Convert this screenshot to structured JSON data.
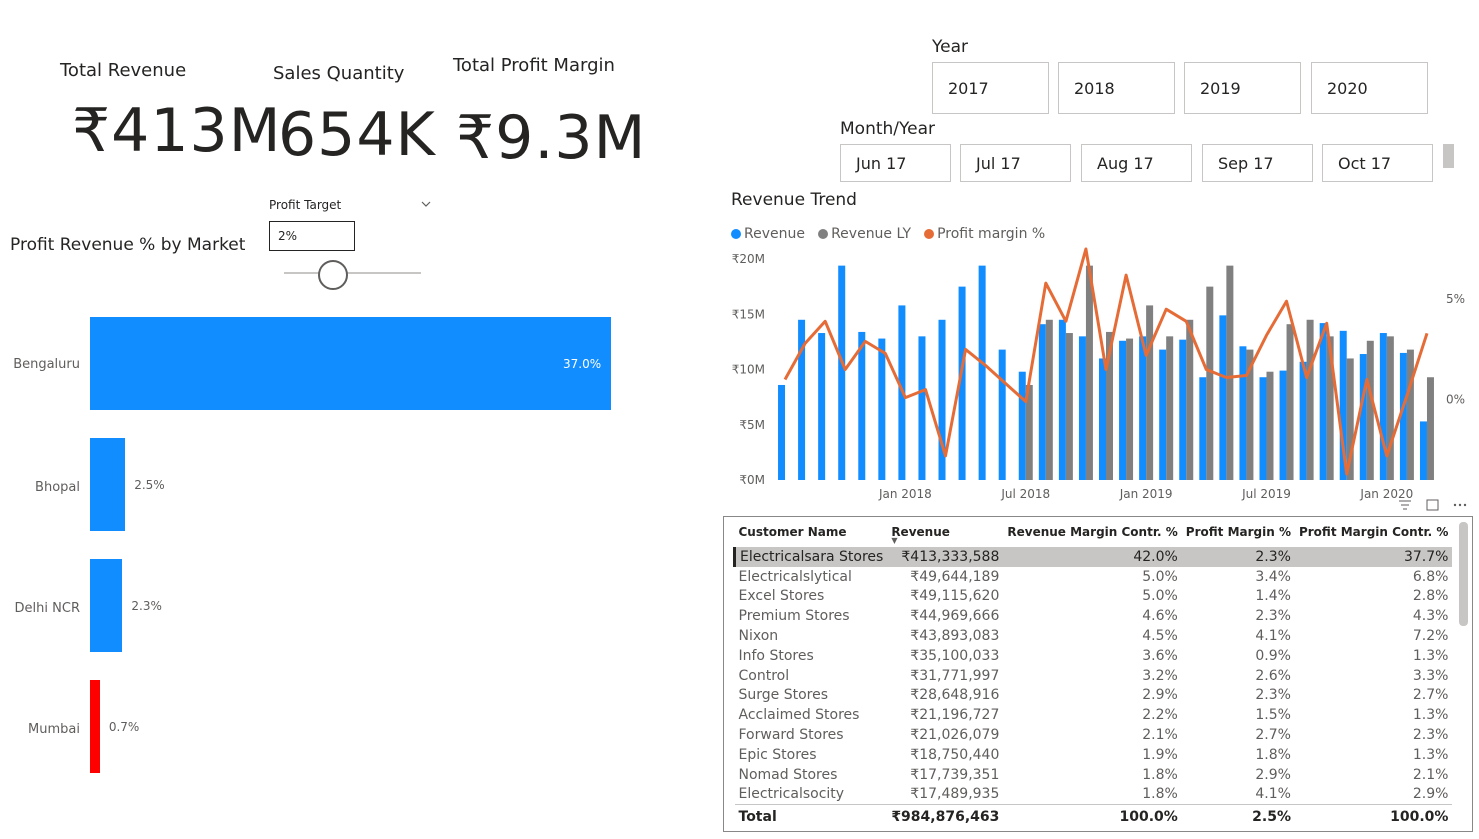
{
  "kpis": {
    "revenue": {
      "title": "Total Revenue",
      "value": "₹413M"
    },
    "quantity": {
      "title": "Sales Quantity",
      "value": "654K"
    },
    "profit": {
      "title": "Total Profit Margin",
      "value": "₹9.3M"
    }
  },
  "profit_target": {
    "label": "Profit Target",
    "value": "2%",
    "slider_fraction": 0.36
  },
  "market_chart": {
    "title": "Profit Revenue % by Market",
    "bars": [
      {
        "name": "Bengaluru",
        "value": 37.0,
        "label": "37.0%",
        "color": "#118DFF"
      },
      {
        "name": "Bhopal",
        "value": 2.5,
        "label": "2.5%",
        "color": "#118DFF"
      },
      {
        "name": "Delhi NCR",
        "value": 2.3,
        "label": "2.3%",
        "color": "#118DFF"
      },
      {
        "name": "Mumbai",
        "value": 0.7,
        "label": "0.7%",
        "color": "#FF0000"
      }
    ]
  },
  "year_slicer": {
    "title": "Year",
    "options": [
      "2017",
      "2018",
      "2019",
      "2020"
    ]
  },
  "month_slicer": {
    "title": "Month/Year",
    "options": [
      "Jun 17",
      "Jul 17",
      "Aug 17",
      "Sep 17",
      "Oct 17"
    ]
  },
  "chart_data": {
    "type": "bar",
    "title": "Revenue Trend",
    "legend": [
      "Revenue",
      "Revenue LY",
      "Profit margin %"
    ],
    "colors": {
      "revenue": "#118DFF",
      "revenue_ly": "#808080",
      "profit": "#E66C37"
    },
    "y_ticks": [
      "₹0M",
      "₹5M",
      "₹10M",
      "₹15M",
      "₹20M"
    ],
    "y2_ticks": [
      "0%",
      "5%"
    ],
    "x_ticks": [
      "Jan 2018",
      "Jul 2018",
      "Jan 2019",
      "Jul 2019",
      "Jan 2020"
    ],
    "ylim": [
      0,
      20
    ],
    "y2lim": [
      -4,
      7
    ],
    "series": [
      {
        "name": "Revenue",
        "values": [
          8.6,
          14.5,
          13.3,
          19.4,
          13.4,
          12.8,
          15.8,
          13.0,
          14.5,
          17.5,
          19.4,
          11.8,
          9.8,
          14.1,
          14.5,
          13.0,
          11.0,
          12.6,
          13.0,
          11.8,
          12.7,
          9.3,
          14.9,
          12.1,
          9.3,
          9.9,
          10.7,
          14.2,
          13.5,
          11.4,
          13.3,
          11.5,
          5.3
        ]
      },
      {
        "name": "Revenue LY",
        "values": [
          null,
          null,
          null,
          null,
          null,
          null,
          null,
          null,
          null,
          null,
          null,
          null,
          8.6,
          14.5,
          13.3,
          19.4,
          13.4,
          12.8,
          15.8,
          13.0,
          14.5,
          17.5,
          19.4,
          11.8,
          9.8,
          14.1,
          14.5,
          13.0,
          11.0,
          12.6,
          13.0,
          11.8,
          9.3
        ]
      },
      {
        "name": "Profit margin %",
        "values": [
          1.0,
          2.8,
          3.9,
          1.5,
          2.9,
          2.3,
          0.1,
          0.5,
          -2.8,
          2.5,
          1.7,
          0.8,
          -0.1,
          5.8,
          3.9,
          7.5,
          1.5,
          6.2,
          2.2,
          4.5,
          3.9,
          1.5,
          1.1,
          1.2,
          3.2,
          4.9,
          1.1,
          3.8,
          -3.7,
          1.0,
          -2.8,
          0.2,
          3.3
        ]
      }
    ]
  },
  "customer_table": {
    "columns": [
      "Customer Name",
      "Revenue",
      "Revenue Margin Contr. %",
      "Profit Margin %",
      "Profit Margin Contr. %"
    ],
    "rows": [
      [
        "Electricalsara Stores",
        "₹413,333,588",
        "42.0%",
        "2.3%",
        "37.7%"
      ],
      [
        "Electricalslytical",
        "₹49,644,189",
        "5.0%",
        "3.4%",
        "6.8%"
      ],
      [
        "Excel Stores",
        "₹49,115,620",
        "5.0%",
        "1.4%",
        "2.8%"
      ],
      [
        "Premium Stores",
        "₹44,969,666",
        "4.6%",
        "2.3%",
        "4.3%"
      ],
      [
        "Nixon",
        "₹43,893,083",
        "4.5%",
        "4.1%",
        "7.2%"
      ],
      [
        "Info Stores",
        "₹35,100,033",
        "3.6%",
        "0.9%",
        "1.3%"
      ],
      [
        "Control",
        "₹31,771,997",
        "3.2%",
        "2.6%",
        "3.3%"
      ],
      [
        "Surge Stores",
        "₹28,648,916",
        "2.9%",
        "2.3%",
        "2.7%"
      ],
      [
        "Acclaimed Stores",
        "₹21,196,727",
        "2.2%",
        "1.5%",
        "1.3%"
      ],
      [
        "Forward Stores",
        "₹21,026,079",
        "2.1%",
        "2.7%",
        "2.3%"
      ],
      [
        "Epic Stores",
        "₹18,750,440",
        "1.9%",
        "1.8%",
        "1.3%"
      ],
      [
        "Nomad Stores",
        "₹17,739,351",
        "1.8%",
        "2.9%",
        "2.1%"
      ],
      [
        "Electricalsocity",
        "₹17,489,935",
        "1.8%",
        "4.1%",
        "2.9%"
      ]
    ],
    "total": [
      "Total",
      "₹984,876,463",
      "100.0%",
      "2.5%",
      "100.0%"
    ]
  }
}
